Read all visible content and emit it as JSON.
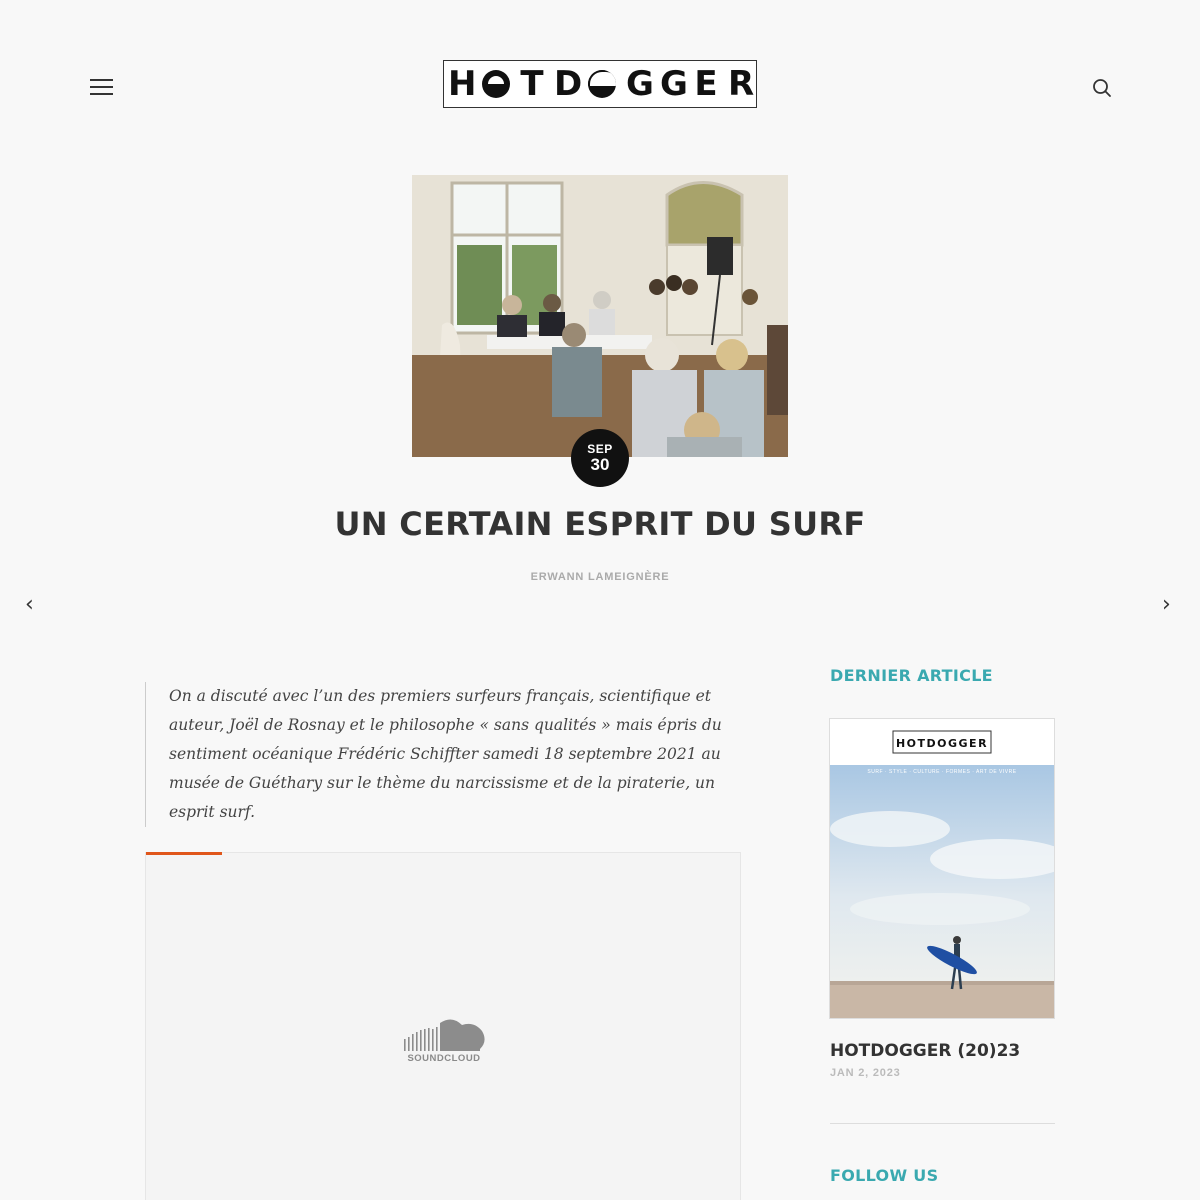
{
  "header": {
    "logo_text": "HOTDOGGER",
    "menu_icon": "hamburger-menu-icon",
    "search_icon": "search-icon"
  },
  "post": {
    "date_month": "SEP",
    "date_day": "30",
    "title": "UN CERTAIN ESPRIT DU SURF",
    "author": "ERWANN LAMEIGNÈRE",
    "excerpt": "On a discuté avec l’un des premiers surfeurs français, scientifique et auteur, Joël de Rosnay et le philosophe « sans qualités » mais épris du sentiment océanique Frédéric Schiffter samedi 18 septembre 2021 au musée de Guéthary sur le thème du narcissisme et de la piraterie, un esprit surf."
  },
  "nav": {
    "prev_arrow": "‹",
    "next_arrow": "›"
  },
  "embed": {
    "provider_label": "SOUNDCLOUD",
    "accent_color": "#e0561a"
  },
  "sidebar": {
    "latest_heading": "DERNIER ARTICLE",
    "latest": {
      "cover_logo": "HOTDOGGER",
      "cover_tagline": "SURF · STYLE · CULTURE · FORMES · ART DE VIVRE",
      "title": "HOTDOGGER (20)23",
      "date": "JAN 2, 2023"
    },
    "follow_heading": "FOLLOW US",
    "accent_color": "#3aa9b0"
  }
}
